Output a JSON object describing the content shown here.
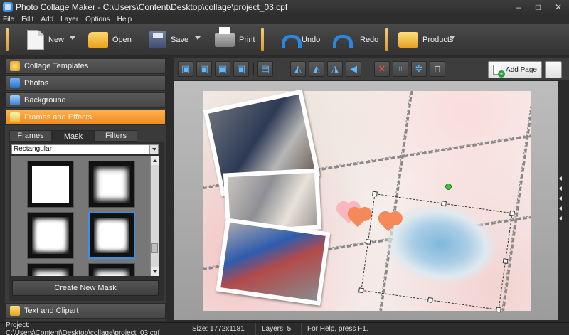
{
  "window": {
    "title": "Photo Collage Maker - C:\\Users\\Content\\Desktop\\collage\\project_03.cpf",
    "minimize": "–",
    "maximize": "□",
    "close": "✕"
  },
  "menu": [
    {
      "label": "File"
    },
    {
      "label": "Edit"
    },
    {
      "label": "Add"
    },
    {
      "label": "Layer"
    },
    {
      "label": "Options"
    },
    {
      "label": "Help"
    }
  ],
  "toolbar": {
    "new_label": "New",
    "open_label": "Open",
    "save_label": "Save",
    "print_label": "Print",
    "undo_label": "Undo",
    "redo_label": "Redo",
    "products_label": "Products"
  },
  "left_panel": {
    "sections": [
      {
        "label": "Collage Templates"
      },
      {
        "label": "Photos"
      },
      {
        "label": "Background"
      },
      {
        "label": "Frames and Effects"
      }
    ],
    "tabs": [
      {
        "label": "Frames"
      },
      {
        "label": "Mask"
      },
      {
        "label": "Filters"
      }
    ],
    "mask_type": "Rectangular",
    "create_mask_label": "Create New Mask",
    "bottom_section": "Text and Clipart"
  },
  "work_toolbar": {
    "add_page_label": "Add Page"
  },
  "status": {
    "project": "Project: C:\\Users\\Content\\Desktop\\collage\\project_03.cpf",
    "size": "Size: 1772x1181",
    "layers": "Layers: 5",
    "help": "For Help, press F1."
  },
  "colors": {
    "accent_orange": "#f08a1c",
    "selection_blue": "#3a90e8",
    "rotate_handle_green": "#41c041",
    "heart_pink": "#f9b7c0",
    "heart_orange": "#f5895a"
  }
}
